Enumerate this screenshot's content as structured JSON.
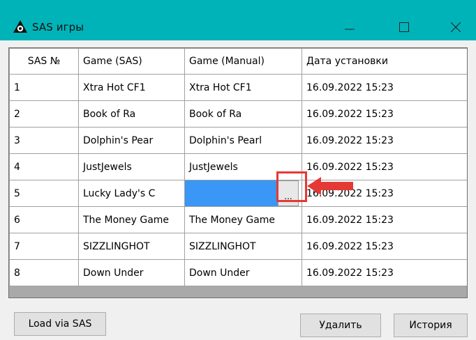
{
  "window": {
    "title": "SAS игры",
    "icon": "sas-logo-icon",
    "controls": [
      "minimize-icon",
      "maximize-icon",
      "close-icon"
    ]
  },
  "table": {
    "headers": [
      "SAS №",
      "Game (SAS)",
      "Game (Manual)",
      "Дата установки"
    ],
    "rows": [
      [
        "1",
        "Xtra Hot CF1",
        "Xtra Hot CF1",
        "16.09.2022 15:23"
      ],
      [
        "2",
        "Book of Ra",
        "Book of Ra",
        "16.09.2022 15:23"
      ],
      [
        "3",
        "Dolphin's Pear",
        "Dolphin's Pearl",
        "16.09.2022 15:23"
      ],
      [
        "4",
        "JustJewels",
        "JustJewels",
        "16.09.2022 15:23"
      ],
      [
        "5",
        "Lucky Lady's C",
        "",
        "16.09.2022 15:23"
      ],
      [
        "6",
        "The Money Game",
        "The Money Game",
        "16.09.2022 15:23"
      ],
      [
        "7",
        "SIZZLINGHOT",
        "SIZZLINGHOT",
        "16.09.2022 15:23"
      ],
      [
        "8",
        "Down Under",
        "Down Under",
        "16.09.2022 15:23"
      ]
    ],
    "ellipsis_label": "..."
  },
  "buttons": {
    "load": "Load via SAS",
    "delete": "Удалить",
    "history": "История"
  },
  "colors": {
    "titlebar": "#00b3b8",
    "selection": "#3a97f5",
    "highlight": "#e53935"
  }
}
